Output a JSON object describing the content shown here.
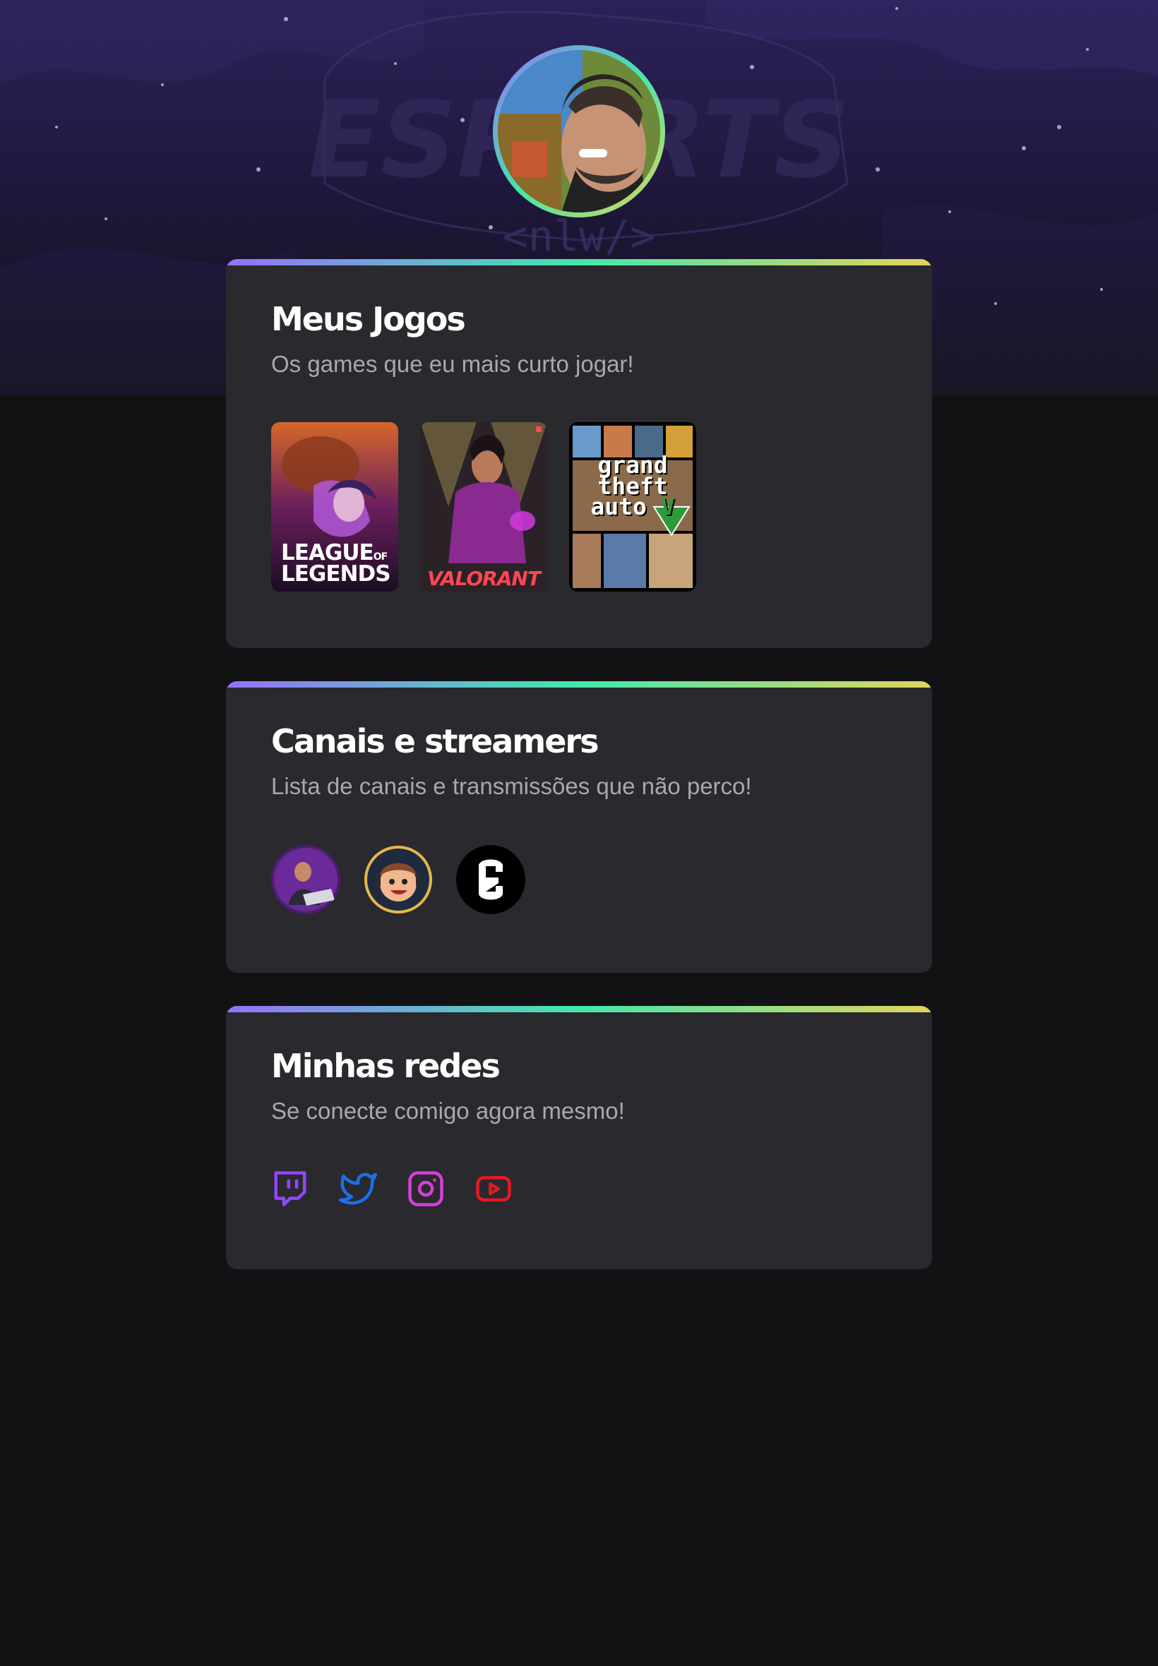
{
  "profile": {
    "avatar_icon": "profile-photo",
    "ring_gradient": [
      "#9572fc",
      "#43e7ad",
      "#e2d45c"
    ]
  },
  "background": {
    "watermark_text": "ESPORTS",
    "watermark_sub": "<nlw/>"
  },
  "games": {
    "title": "Meus Jogos",
    "subtitle": "Os games que eu mais curto jogar!",
    "items": [
      {
        "label_line1": "LEAGUE",
        "label_small": "OF",
        "label_line2": "LEGENDS"
      },
      {
        "label": "VALORANT"
      },
      {
        "label_line1": "grand",
        "label_line2": "theft",
        "label_line3": "auto",
        "label_badge": "V"
      }
    ]
  },
  "streamers": {
    "title": "Canais e streamers",
    "subtitle": "Lista de canais e transmissões que não perco!",
    "items": [
      {
        "icon": "streamer-avatar-1"
      },
      {
        "icon": "streamer-avatar-2"
      },
      {
        "icon": "streamer-avatar-3"
      }
    ]
  },
  "social": {
    "title": "Minhas redes",
    "subtitle": "Se conecte comigo agora mesmo!",
    "items": [
      {
        "icon": "twitch-icon",
        "color": "#9147ff"
      },
      {
        "icon": "twitter-icon",
        "color": "#1d70e8"
      },
      {
        "icon": "instagram-icon",
        "color": "#d63fd9"
      },
      {
        "icon": "youtube-icon",
        "color": "#e11b23"
      }
    ]
  },
  "colors": {
    "background": "#121214",
    "card": "#29292e",
    "title": "#ffffff",
    "subtitle": "#a8a8b3"
  }
}
